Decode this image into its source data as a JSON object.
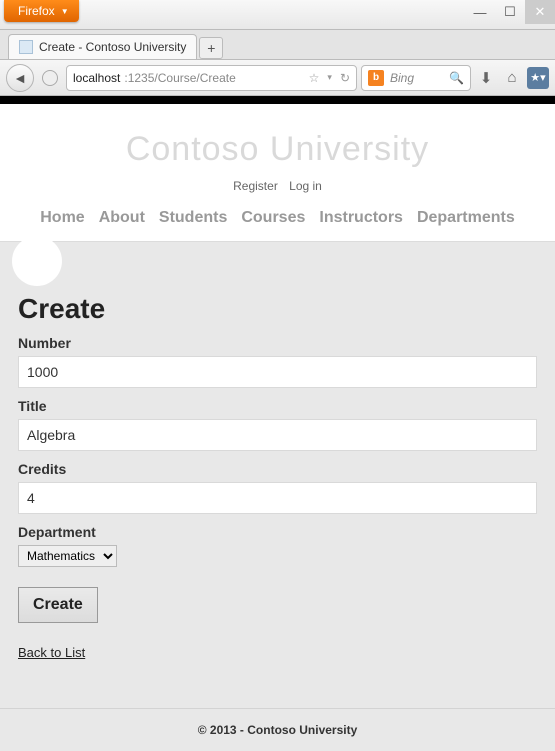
{
  "browser": {
    "name": "Firefox",
    "tab_title": "Create - Contoso University",
    "url_host": "localhost",
    "url_port_path": ":1235/Course/Create",
    "search_placeholder": "Bing"
  },
  "site": {
    "title": "Contoso University",
    "auth": {
      "register": "Register",
      "login": "Log in"
    },
    "nav": [
      "Home",
      "About",
      "Students",
      "Courses",
      "Instructors",
      "Departments"
    ]
  },
  "page": {
    "heading": "Create",
    "fields": {
      "number": {
        "label": "Number",
        "value": "1000"
      },
      "title": {
        "label": "Title",
        "value": "Algebra"
      },
      "credits": {
        "label": "Credits",
        "value": "4"
      },
      "department": {
        "label": "Department",
        "selected": "Mathematics"
      }
    },
    "submit_label": "Create",
    "back_link": "Back to List"
  },
  "footer": "© 2013 - Contoso University"
}
